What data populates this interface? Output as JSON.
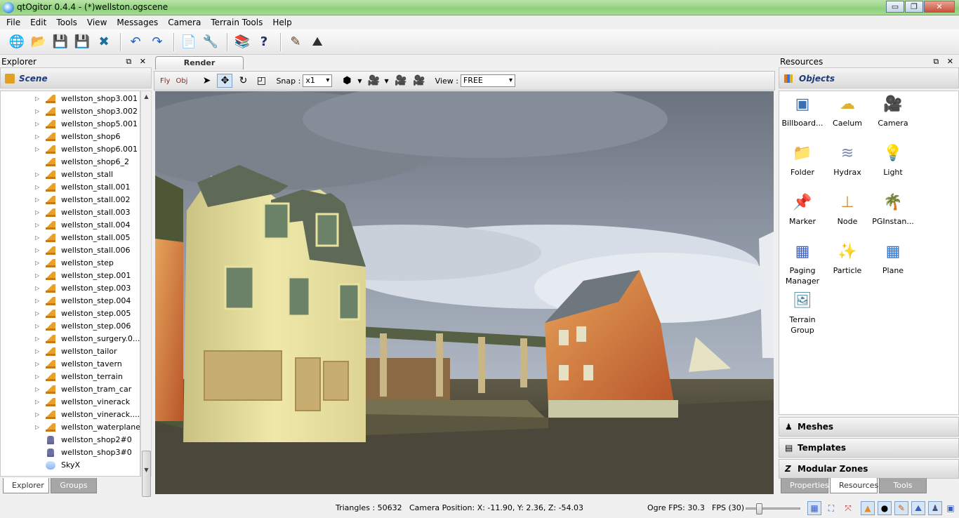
{
  "window": {
    "title": "qtOgitor 0.4.4 - (*)wellston.ogscene",
    "minimize": "▭",
    "maximize": "❐",
    "close": "✕"
  },
  "menu": [
    "File",
    "Edit",
    "Tools",
    "View",
    "Messages",
    "Camera",
    "Terrain Tools",
    "Help"
  ],
  "toolbar": {
    "icons": [
      "globe-icon",
      "open-folder-icon",
      "save-icon",
      "save-as-icon",
      "close-scene-icon",
      "undo-icon",
      "redo-icon",
      "export-icon",
      "tools-icon",
      "library-icon",
      "help-icon",
      "edit-icon",
      "terrain-icon"
    ],
    "glyphs": [
      "🌐",
      "📂",
      "💾",
      "💾",
      "✖",
      "↶",
      "↷",
      "📄",
      "🔧",
      "📚",
      "?",
      "✎",
      "⛰"
    ]
  },
  "explorer": {
    "title": "Explorer",
    "controls": "⧉ ✕",
    "scene_label": "Scene",
    "items": [
      {
        "label": "wellston_shop3.001",
        "icon": "entity-icon",
        "expand": true
      },
      {
        "label": "wellston_shop3.002",
        "icon": "entity-icon",
        "expand": true
      },
      {
        "label": "wellston_shop5.001",
        "icon": "entity-icon",
        "expand": true
      },
      {
        "label": "wellston_shop6",
        "icon": "entity-icon",
        "expand": true
      },
      {
        "label": "wellston_shop6.001",
        "icon": "entity-icon",
        "expand": true
      },
      {
        "label": "wellston_shop6_2",
        "icon": "entity-icon",
        "expand": false
      },
      {
        "label": "wellston_stall",
        "icon": "entity-icon",
        "expand": true
      },
      {
        "label": "wellston_stall.001",
        "icon": "entity-icon",
        "expand": true
      },
      {
        "label": "wellston_stall.002",
        "icon": "entity-icon",
        "expand": true
      },
      {
        "label": "wellston_stall.003",
        "icon": "entity-icon",
        "expand": true
      },
      {
        "label": "wellston_stall.004",
        "icon": "entity-icon",
        "expand": true
      },
      {
        "label": "wellston_stall.005",
        "icon": "entity-icon",
        "expand": true
      },
      {
        "label": "wellston_stall.006",
        "icon": "entity-icon",
        "expand": true
      },
      {
        "label": "wellston_step",
        "icon": "entity-icon",
        "expand": true
      },
      {
        "label": "wellston_step.001",
        "icon": "entity-icon",
        "expand": true
      },
      {
        "label": "wellston_step.003",
        "icon": "entity-icon",
        "expand": true
      },
      {
        "label": "wellston_step.004",
        "icon": "entity-icon",
        "expand": true
      },
      {
        "label": "wellston_step.005",
        "icon": "entity-icon",
        "expand": true
      },
      {
        "label": "wellston_step.006",
        "icon": "entity-icon",
        "expand": true
      },
      {
        "label": "wellston_surgery.0...",
        "icon": "entity-icon",
        "expand": true
      },
      {
        "label": "wellston_tailor",
        "icon": "entity-icon",
        "expand": true
      },
      {
        "label": "wellston_tavern",
        "icon": "entity-icon",
        "expand": true
      },
      {
        "label": "wellston_terrain",
        "icon": "entity-icon",
        "expand": true
      },
      {
        "label": "wellston_tram_car",
        "icon": "entity-icon",
        "expand": true
      },
      {
        "label": "wellston_vinerack",
        "icon": "entity-icon",
        "expand": true
      },
      {
        "label": "wellston_vinerack....",
        "icon": "entity-icon",
        "expand": true
      },
      {
        "label": "wellston_waterplane",
        "icon": "entity-icon",
        "expand": true
      },
      {
        "label": "wellston_shop2#0",
        "icon": "figure-icon",
        "expand": false
      },
      {
        "label": "wellston_shop3#0",
        "icon": "figure-icon",
        "expand": false
      },
      {
        "label": "SkyX",
        "icon": "sky-icon",
        "expand": false
      }
    ],
    "tabs": [
      "Explorer",
      "Groups"
    ]
  },
  "render": {
    "tab": "Render",
    "fly": "Fly",
    "obj": "Obj",
    "snap_label": "Snap :",
    "snap_value": "x1",
    "view_label": "View :",
    "view_value": "FREE"
  },
  "resources": {
    "title": "Resources",
    "controls": "⧉ ✕",
    "objects_label": "Objects",
    "objects": [
      {
        "label": "Billboard...",
        "icon": "billboard-icon",
        "glyph": "▣",
        "color": "#3a6fb0"
      },
      {
        "label": "Caelum",
        "icon": "cloud-icon",
        "glyph": "☁",
        "color": "#e0b030"
      },
      {
        "label": "Camera",
        "icon": "camera-icon",
        "glyph": "🎥",
        "color": "#222222"
      },
      {
        "label": "Folder",
        "icon": "folder-icon",
        "glyph": "📁",
        "color": "#e8b020"
      },
      {
        "label": "Hydrax",
        "icon": "waves-icon",
        "glyph": "≋",
        "color": "#7a8aa8"
      },
      {
        "label": "Light",
        "icon": "lightbulb-icon",
        "glyph": "💡",
        "color": "#e8c830"
      },
      {
        "label": "Marker",
        "icon": "pin-icon",
        "glyph": "📌",
        "color": "#d02020"
      },
      {
        "label": "Node",
        "icon": "node-icon",
        "glyph": "⊥",
        "color": "#d09030"
      },
      {
        "label": "PGInstan...",
        "icon": "palm-icon",
        "glyph": "🌴",
        "color": "#208a30"
      },
      {
        "label": "Paging Manager",
        "icon": "grid-icon",
        "glyph": "▦",
        "color": "#3a5fc0"
      },
      {
        "label": "Particle",
        "icon": "wand-icon",
        "glyph": "✨",
        "color": "#c07020"
      },
      {
        "label": "Plane",
        "icon": "plane-icon",
        "glyph": "▦",
        "color": "#2a70d0"
      },
      {
        "label": "Terrain Group",
        "icon": "terrain-icon",
        "glyph": "🖼",
        "color": "#4a8aa0"
      }
    ],
    "sections": [
      "Meshes",
      "Templates",
      "Modular Zones"
    ],
    "tabs": [
      "Properties",
      "Resources",
      "Tools"
    ]
  },
  "status": {
    "triangles": "Triangles : 50632",
    "camera": "Camera Position: X: -11.90, Y:  2.36, Z: -54.03",
    "ogre_fps": "Ogre FPS: 30.3",
    "fps_label": "FPS (30)",
    "fps_fraction": 0.2
  }
}
